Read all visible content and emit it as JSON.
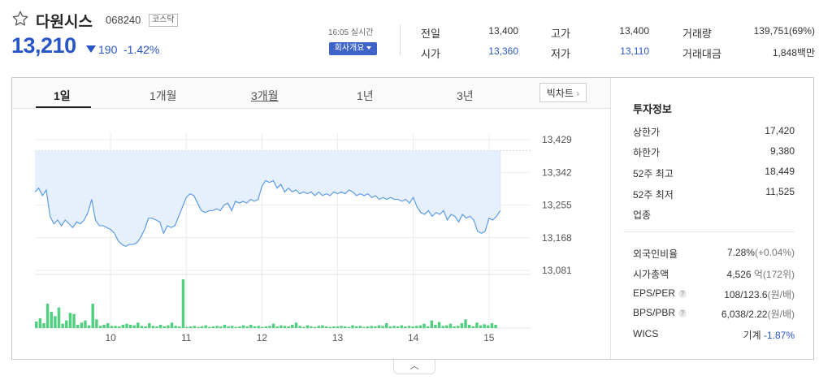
{
  "stock": {
    "name": "다원시스",
    "code": "068240",
    "market": "코스닥",
    "price": "13,210",
    "change": "190",
    "change_pct": "-1.42%",
    "realtime": "16:05 실시간",
    "company_button": "회사개요"
  },
  "summary": [
    {
      "label": "전일",
      "value": "13,400",
      "color": "#333333"
    },
    {
      "label": "고가",
      "value": "13,400",
      "color": "#333333"
    },
    {
      "label": "거래량",
      "value": "139,751(69%)",
      "color": "#333333"
    },
    {
      "label": "시가",
      "value": "13,360",
      "color": "#2956c6"
    },
    {
      "label": "저가",
      "value": "13,110",
      "color": "#2956c6"
    },
    {
      "label": "거래대금",
      "value": "1,848백만",
      "color": "#333333"
    }
  ],
  "tabs": [
    "1일",
    "1개월",
    "3개월",
    "1년",
    "3년"
  ],
  "big_chart_label": "빅차트",
  "invest": {
    "title": "투자정보",
    "items1": [
      {
        "label": "상한가",
        "value": "17,420",
        "color": "#e0252c"
      },
      {
        "label": "하한가",
        "value": "9,380",
        "color": "#2956c6"
      },
      {
        "label": "52주 최고",
        "value": "18,449",
        "color": "#333333"
      },
      {
        "label": "52주 최저",
        "value": "11,525",
        "color": "#333333"
      },
      {
        "label": "업종",
        "value": "",
        "color": "#333333"
      }
    ],
    "foreign": {
      "label": "외국인비율",
      "value": "7.28%",
      "sub": "(+0.04%)"
    },
    "mktcap": {
      "label": "시가총액",
      "value": "4,526",
      "sub": "억(172위)"
    },
    "eps": {
      "label": "EPS/PER",
      "value": "108/123.6",
      "sub": "(원/배)"
    },
    "bps": {
      "label": "BPS/PBR",
      "value": "6,038/2.22",
      "sub": "(원/배)"
    },
    "wics": {
      "label": "WICS",
      "value": "기계",
      "sub": "-1.87%"
    }
  },
  "colors": {
    "accent": "#2956c6",
    "line": "#5b9be6",
    "fill": "#e6f0fd",
    "bar": "#4fd07e",
    "up": "#e0252c"
  },
  "icons": {
    "favorite": "star-outline-icon",
    "expand": "chevron-up-icon",
    "bigchart": "chevron-right-icon"
  },
  "chart_data": {
    "type": "line",
    "y_ticks": [
      "13,429",
      "13,342",
      "13,255",
      "13,168",
      "13,081"
    ],
    "ylim": [
      13081,
      13429
    ],
    "reference_line": 13400,
    "x_ticks": [
      "10",
      "11",
      "12",
      "13",
      "14",
      "15"
    ],
    "x_tick_positions": [
      10,
      11,
      12,
      13,
      14,
      15
    ],
    "xlim": [
      9.0,
      15.55
    ],
    "price_series": [
      {
        "x": 9.0,
        "y": 13290
      },
      {
        "x": 9.05,
        "y": 13300
      },
      {
        "x": 9.1,
        "y": 13280
      },
      {
        "x": 9.15,
        "y": 13295
      },
      {
        "x": 9.2,
        "y": 13225
      },
      {
        "x": 9.25,
        "y": 13205
      },
      {
        "x": 9.3,
        "y": 13215
      },
      {
        "x": 9.35,
        "y": 13200
      },
      {
        "x": 9.4,
        "y": 13215
      },
      {
        "x": 9.45,
        "y": 13205
      },
      {
        "x": 9.5,
        "y": 13195
      },
      {
        "x": 9.55,
        "y": 13210
      },
      {
        "x": 9.6,
        "y": 13205
      },
      {
        "x": 9.65,
        "y": 13215
      },
      {
        "x": 9.7,
        "y": 13235
      },
      {
        "x": 9.75,
        "y": 13270
      },
      {
        "x": 9.8,
        "y": 13215
      },
      {
        "x": 9.85,
        "y": 13200
      },
      {
        "x": 9.9,
        "y": 13200
      },
      {
        "x": 9.95,
        "y": 13195
      },
      {
        "x": 10.0,
        "y": 13190
      },
      {
        "x": 10.05,
        "y": 13180
      },
      {
        "x": 10.1,
        "y": 13160
      },
      {
        "x": 10.15,
        "y": 13150
      },
      {
        "x": 10.2,
        "y": 13145
      },
      {
        "x": 10.25,
        "y": 13150
      },
      {
        "x": 10.3,
        "y": 13150
      },
      {
        "x": 10.35,
        "y": 13155
      },
      {
        "x": 10.4,
        "y": 13170
      },
      {
        "x": 10.45,
        "y": 13190
      },
      {
        "x": 10.5,
        "y": 13220
      },
      {
        "x": 10.55,
        "y": 13220
      },
      {
        "x": 10.6,
        "y": 13215
      },
      {
        "x": 10.65,
        "y": 13210
      },
      {
        "x": 10.7,
        "y": 13180
      },
      {
        "x": 10.75,
        "y": 13200
      },
      {
        "x": 10.8,
        "y": 13195
      },
      {
        "x": 10.85,
        "y": 13200
      },
      {
        "x": 10.9,
        "y": 13225
      },
      {
        "x": 10.95,
        "y": 13250
      },
      {
        "x": 11.0,
        "y": 13275
      },
      {
        "x": 11.05,
        "y": 13285
      },
      {
        "x": 11.1,
        "y": 13280
      },
      {
        "x": 11.15,
        "y": 13260
      },
      {
        "x": 11.2,
        "y": 13240
      },
      {
        "x": 11.25,
        "y": 13235
      },
      {
        "x": 11.3,
        "y": 13240
      },
      {
        "x": 11.35,
        "y": 13240
      },
      {
        "x": 11.4,
        "y": 13245
      },
      {
        "x": 11.45,
        "y": 13240
      },
      {
        "x": 11.5,
        "y": 13255
      },
      {
        "x": 11.55,
        "y": 13260
      },
      {
        "x": 11.6,
        "y": 13240
      },
      {
        "x": 11.65,
        "y": 13265
      },
      {
        "x": 11.7,
        "y": 13260
      },
      {
        "x": 11.75,
        "y": 13265
      },
      {
        "x": 11.8,
        "y": 13260
      },
      {
        "x": 11.85,
        "y": 13270
      },
      {
        "x": 11.9,
        "y": 13265
      },
      {
        "x": 11.95,
        "y": 13270
      },
      {
        "x": 12.0,
        "y": 13305
      },
      {
        "x": 12.05,
        "y": 13320
      },
      {
        "x": 12.1,
        "y": 13315
      },
      {
        "x": 12.15,
        "y": 13320
      },
      {
        "x": 12.2,
        "y": 13300
      },
      {
        "x": 12.25,
        "y": 13310
      },
      {
        "x": 12.3,
        "y": 13290
      },
      {
        "x": 12.35,
        "y": 13300
      },
      {
        "x": 12.4,
        "y": 13290
      },
      {
        "x": 12.45,
        "y": 13295
      },
      {
        "x": 12.5,
        "y": 13285
      },
      {
        "x": 12.55,
        "y": 13290
      },
      {
        "x": 12.6,
        "y": 13285
      },
      {
        "x": 12.65,
        "y": 13290
      },
      {
        "x": 12.7,
        "y": 13280
      },
      {
        "x": 12.75,
        "y": 13290
      },
      {
        "x": 12.8,
        "y": 13280
      },
      {
        "x": 12.85,
        "y": 13285
      },
      {
        "x": 12.9,
        "y": 13280
      },
      {
        "x": 12.95,
        "y": 13290
      },
      {
        "x": 13.0,
        "y": 13285
      },
      {
        "x": 13.05,
        "y": 13290
      },
      {
        "x": 13.1,
        "y": 13285
      },
      {
        "x": 13.15,
        "y": 13295
      },
      {
        "x": 13.2,
        "y": 13290
      },
      {
        "x": 13.25,
        "y": 13280
      },
      {
        "x": 13.3,
        "y": 13285
      },
      {
        "x": 13.35,
        "y": 13280
      },
      {
        "x": 13.4,
        "y": 13285
      },
      {
        "x": 13.45,
        "y": 13275
      },
      {
        "x": 13.5,
        "y": 13280
      },
      {
        "x": 13.55,
        "y": 13270
      },
      {
        "x": 13.6,
        "y": 13275
      },
      {
        "x": 13.65,
        "y": 13270
      },
      {
        "x": 13.7,
        "y": 13275
      },
      {
        "x": 13.75,
        "y": 13270
      },
      {
        "x": 13.8,
        "y": 13270
      },
      {
        "x": 13.85,
        "y": 13265
      },
      {
        "x": 13.9,
        "y": 13270
      },
      {
        "x": 13.95,
        "y": 13260
      },
      {
        "x": 14.0,
        "y": 13275
      },
      {
        "x": 14.05,
        "y": 13250
      },
      {
        "x": 14.1,
        "y": 13235
      },
      {
        "x": 14.15,
        "y": 13230
      },
      {
        "x": 14.2,
        "y": 13240
      },
      {
        "x": 14.25,
        "y": 13225
      },
      {
        "x": 14.3,
        "y": 13235
      },
      {
        "x": 14.35,
        "y": 13230
      },
      {
        "x": 14.4,
        "y": 13240
      },
      {
        "x": 14.45,
        "y": 13215
      },
      {
        "x": 14.5,
        "y": 13230
      },
      {
        "x": 14.55,
        "y": 13225
      },
      {
        "x": 14.6,
        "y": 13210
      },
      {
        "x": 14.65,
        "y": 13230
      },
      {
        "x": 14.7,
        "y": 13220
      },
      {
        "x": 14.75,
        "y": 13225
      },
      {
        "x": 14.8,
        "y": 13215
      },
      {
        "x": 14.85,
        "y": 13185
      },
      {
        "x": 14.9,
        "y": 13180
      },
      {
        "x": 14.95,
        "y": 13185
      },
      {
        "x": 15.0,
        "y": 13220
      },
      {
        "x": 15.05,
        "y": 13215
      },
      {
        "x": 15.1,
        "y": 13225
      },
      {
        "x": 15.15,
        "y": 13240
      }
    ],
    "volume_series": [
      12,
      18,
      9,
      45,
      30,
      22,
      38,
      8,
      14,
      28,
      26,
      6,
      10,
      14,
      5,
      45,
      16,
      4,
      6,
      9,
      4,
      4,
      3,
      6,
      8,
      6,
      5,
      10,
      4,
      3,
      9,
      4,
      3,
      6,
      3,
      5,
      10,
      4,
      3,
      90,
      2,
      3,
      4,
      2,
      3,
      5,
      2,
      3,
      4,
      3,
      6,
      3,
      4,
      2,
      3,
      5,
      3,
      6,
      3,
      4,
      2,
      3,
      4,
      8,
      3,
      5,
      4,
      3,
      6,
      10,
      4,
      2,
      5,
      3,
      2,
      4,
      5,
      3,
      2,
      3,
      3,
      4,
      3,
      2,
      5,
      3,
      4,
      2,
      3,
      4,
      3,
      5,
      4,
      9,
      3,
      4,
      3,
      5,
      3,
      4,
      3,
      4,
      5,
      8,
      3,
      14,
      6,
      11,
      4,
      5,
      8,
      3,
      4,
      9,
      16,
      6,
      3,
      10,
      5,
      7,
      5,
      9,
      6
    ]
  }
}
